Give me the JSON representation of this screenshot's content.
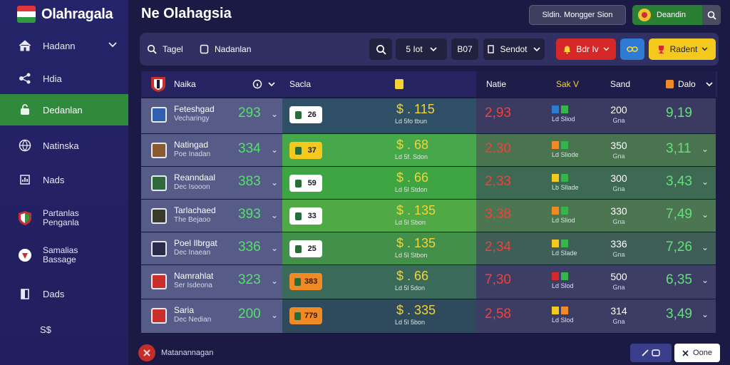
{
  "app": {
    "title": "Olahragala",
    "page_title": "Ne Olahagsia"
  },
  "colors": {
    "accent_green": "#2f8a3c",
    "odds_red": "#f0413c",
    "score_green": "#63e07a",
    "money_yellow": "#f5d331",
    "sidebar": "#25246a"
  },
  "sidebar": {
    "items": [
      {
        "label": "Hadann",
        "icon": "home-icon"
      },
      {
        "label": "Hdia",
        "icon": "share-icon"
      },
      {
        "label": "Dedanlan",
        "icon": "lock-icon"
      },
      {
        "label": "Natinska",
        "icon": "globe-icon"
      },
      {
        "label": "Nads",
        "icon": "chart-icon"
      },
      {
        "label": "Partanlas",
        "label2": "Penganla",
        "icon": "crest-icon"
      },
      {
        "label": "Samalias",
        "label2": "Bassage",
        "icon": "shield-icon"
      },
      {
        "label": "Dads",
        "icon": "door-icon"
      },
      {
        "label": "S$",
        "icon": ""
      }
    ]
  },
  "header": {
    "user_btn": "Sldin. Mongger Sion",
    "account_btn": "Deandin"
  },
  "filters": {
    "tagel": "Tagel",
    "nadanlan": "Nadanlan",
    "range": "5 Iot",
    "code": "B07",
    "sendot": "Sendot",
    "red_btn": "Bdr Iv",
    "yellow_btn": "Radent"
  },
  "table": {
    "headers": {
      "team": "Naika",
      "col2": "Sacla",
      "col4": "Natie",
      "col5": "Sak V",
      "col6": "Sand",
      "col7": "Dalo"
    },
    "rows": [
      {
        "name": "Feteshgad",
        "sub": "Vecharingy",
        "num": "293",
        "chip": "26",
        "money": "$ . 115",
        "money_sub": "Ld 5fo tbun",
        "odds": "2,93",
        "icons_sub": "Ld Sliod",
        "stat": "200",
        "stat_sub": "Gna",
        "score": "9,19"
      },
      {
        "name": "Natingad",
        "sub": "Poe Inadan",
        "num": "334",
        "chip": "37",
        "money": "$ . 68",
        "money_sub": "Ld 5f. Sdon",
        "odds": "2,30",
        "icons_sub": "Ld Sliode",
        "stat": "350",
        "stat_sub": "Gna",
        "score": "3,11"
      },
      {
        "name": "Reanndaal",
        "sub": "Dec Isooon",
        "num": "383",
        "chip": "59",
        "money": "$ . 66",
        "money_sub": "Ld 5l Stdon",
        "odds": "2,33",
        "icons_sub": "Lb Sllade",
        "stat": "300",
        "stat_sub": "Gna",
        "score": "3,43"
      },
      {
        "name": "Tarlachaed",
        "sub": "The Bejaoo",
        "num": "393",
        "chip": "33",
        "money": "$ . 135",
        "money_sub": "Ld 5l Sbon",
        "odds": "3,38",
        "icons_sub": "Ld Sliod",
        "stat": "330",
        "stat_sub": "Gna",
        "score": "7,49"
      },
      {
        "name": "Poel Ilbrgat",
        "sub": "Dec Inaean",
        "num": "336",
        "chip": "25",
        "money": "$ . 135",
        "money_sub": "Ld 5l Stbon",
        "odds": "2,34",
        "icons_sub": "Ld Slade",
        "stat": "336",
        "stat_sub": "Gna",
        "score": "7,26"
      },
      {
        "name": "Namrahlat",
        "sub": "Ser Isdeona",
        "num": "323",
        "chip": "383",
        "money": "$ . 66",
        "money_sub": "Ld 5l 5don",
        "odds": "7,30",
        "icons_sub": "Ld Slod",
        "stat": "500",
        "stat_sub": "Gna",
        "score": "6,35"
      },
      {
        "name": "Saria",
        "sub": "Dec Nedian",
        "num": "200",
        "chip": "779",
        "money": "$ . 335",
        "money_sub": "Ld 5l 5bon",
        "odds": "2,58",
        "icons_sub": "Ld Slod",
        "stat": "314",
        "stat_sub": "Gna",
        "score": "3,49"
      }
    ]
  },
  "footer": {
    "text": "Matanannagan",
    "btn_right": "Oone"
  }
}
